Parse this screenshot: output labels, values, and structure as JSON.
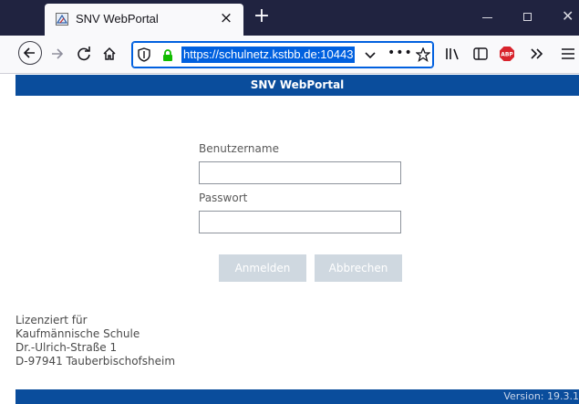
{
  "browser": {
    "tab": {
      "title": "SNV WebPortal",
      "favicon": "school-favicon-icon",
      "close_glyph": "×"
    },
    "new_tab_glyph": "+",
    "window_close_glyph": "✕",
    "address_bar": {
      "url": "https://schulnetz.kstbb.de:10443",
      "more_glyph": "•••"
    },
    "toolbar_icons": [
      "back-icon",
      "forward-icon",
      "reload-icon",
      "home-icon",
      "tracking-shield-icon",
      "lock-icon",
      "url-dropdown-icon",
      "page-actions-icon",
      "bookmark-star-icon",
      "library-icon",
      "sidebar-icon",
      "adblock-plus-icon",
      "overflow-menu-icon",
      "hamburger-menu-icon"
    ],
    "adblock_label": "ABP"
  },
  "page": {
    "header_title": "SNV WebPortal",
    "login": {
      "username_label": "Benutzername",
      "username_value": "",
      "password_label": "Passwort",
      "password_value": "",
      "submit_label": "Anmelden",
      "cancel_label": "Abbrechen"
    },
    "license": {
      "line1": "Lizenziert für",
      "line2": "Kaufmännische Schule",
      "line3": "Dr.-Ulrich-Straße 1",
      "line4": "D-97941 Tauberbischofsheim"
    },
    "version": "Version: 19.3.1"
  },
  "colors": {
    "header_blue": "#0a4d9c",
    "tabbar_dark": "#202340",
    "url_highlight": "#0060df",
    "button_disabled": "#cfd8e0",
    "lock_green": "#12bc00",
    "abp_red": "#d8232c"
  }
}
